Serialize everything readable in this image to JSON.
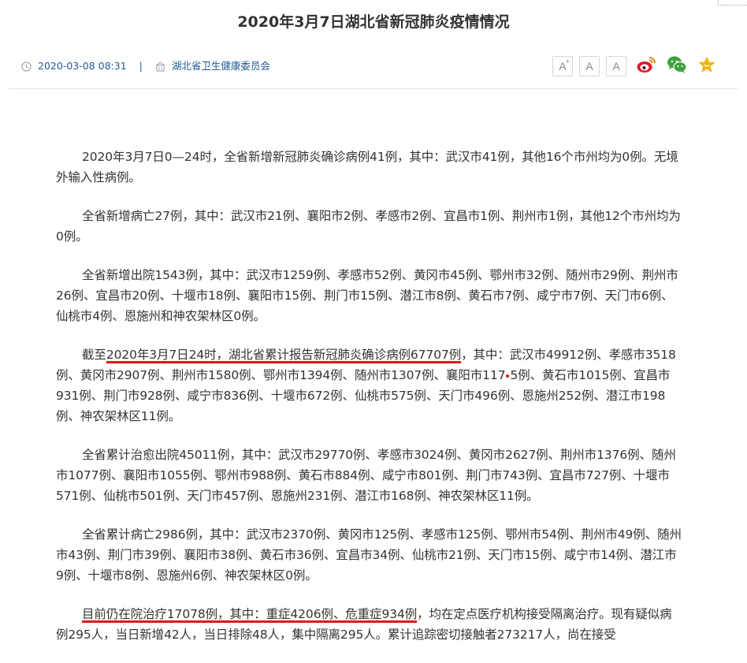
{
  "article": {
    "title": "2020年3月7日湖北省新冠肺炎疫情情况",
    "date": "2020-03-08 08:31",
    "separator": "|",
    "source": "湖北省卫生健康委员会"
  },
  "toolbar": {
    "font_larger": "A",
    "font_larger_mark": "+",
    "font_reset": "A",
    "font_smaller": "A",
    "share_weibo": "weibo-icon",
    "share_wechat": "wechat-icon",
    "favorite": "star-icon"
  },
  "paragraphs": {
    "p1": "2020年3月7日0—24时，全省新增新冠肺炎确诊病例41例，其中：武汉市41例，其他16个市州均为0例。无境外输入性病例。",
    "p2": "全省新增病亡27例，其中：武汉市21例、襄阳市2例、孝感市2例、宜昌市1例、荆州市1例，其他12个市州均为0例。",
    "p3": "全省新增出院1543例，其中：武汉市1259例、孝感市52例、黄冈市45例、鄂州市32例、随州市29例、荆州市26例、宜昌市20例、十堰市18例、襄阳市15例、荆门市15例、潜江市8例、黄石市7例、咸宁市7例、天门市6例、仙桃市4例、恩施州和神农架林区0例。",
    "p4_a": "截至",
    "p4_highlight": "2020年3月7日24时，湖北省累计报告新冠肺炎确诊病例67707例",
    "p4_b": "，其中：武汉市49912例、孝感市3518例、黄冈市2907例、荆州市1580例、鄂州市1394例、随州市1307例、襄阳市117",
    "p4_c": "5例、黄石市1015例、宜昌市931例、荆门市928例、咸宁市836例、十堰市672例、仙桃市575例、天门市496例、恩施州252例、潜江市198例、神农架林区11例。",
    "p5": "全省累计治愈出院45011例，其中：武汉市29770例、孝感市3024例、黄冈市2627例、荆州市1376例、随州市1077例、襄阳市1055例、鄂州市988例、黄石市884例、咸宁市801例、荆门市743例、宜昌市727例、十堰市571例、仙桃市501例、天门市457例、恩施州231例、潜江市168例、神农架林区11例。",
    "p6": "全省累计病亡2986例，其中：武汉市2370例、黄冈市125例、孝感市125例、鄂州市54例、荆州市49例、随州市43例、荆门市39例、襄阳市38例、黄石市36例、宜昌市34例、仙桃市21例、天门市15例、咸宁市14例、潜江市9例、十堰市8例、恩施州6例、神农架林区0例。",
    "p7_highlight": "目前仍在院治疗17078例，其中：重症4206例、危重症934例",
    "p7_b": "，均在定点医疗机构接受隔离治疗。现有疑似病例295人，当日新增42人，当日排除48人，集中隔离295人。累计追踪密切接触者273217人，尚在接受"
  },
  "colors": {
    "link_blue": "#1f5a96",
    "annotation_red": "#e01818",
    "weibo_red": "#e6162d",
    "wechat_green": "#3aa33a",
    "star_gold": "#f0b400"
  }
}
